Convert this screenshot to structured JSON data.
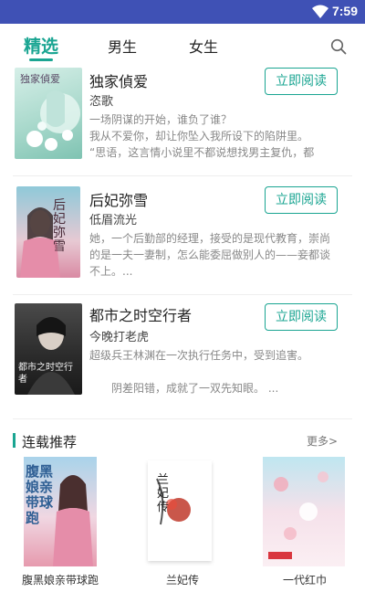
{
  "status_bar": {
    "time": "7:59",
    "wifi_icon": "wifi-icon"
  },
  "tabs": [
    {
      "label": "精选",
      "active": true
    },
    {
      "label": "男生",
      "active": false
    },
    {
      "label": "女生",
      "active": false
    }
  ],
  "search_icon": "search-icon",
  "books": [
    {
      "title": "独家偵爱",
      "author": "恣歌",
      "desc": "一场阴谋的开始，谁负了谁？\n我从不爱你，却让你坠入我所设下的陷阱里。\n“思语，这言情小说里不都说想找男主复仇，都要…",
      "button": "立即阅读",
      "cover_text": "独家偵爱"
    },
    {
      "title": "后妃弥雪",
      "author": "低眉流光",
      "desc": "她，一个后勤部的经理，接受的是现代教育，崇尚的是一夫一妻制，怎么能委屈做别人的——妾都谈不上。...",
      "button": "立即阅读",
      "cover_text": "后妃弥雪"
    },
    {
      "title": "都市之时空行者",
      "author": "今晚打老虎",
      "desc": "超级兵王林渊在一次执行任务中，受到追害。\n\n　　阴差阳错，成就了一双先知眼。 ...",
      "button": "立即阅读",
      "cover_text": "都市之时空行者"
    }
  ],
  "section": {
    "title": "连载推荐",
    "more": "更多>"
  },
  "recommend": [
    {
      "name": "腹黑娘亲带球跑",
      "cover_text": "腹黑娘亲带球跑"
    },
    {
      "name": "兰妃传",
      "cover_text": "兰妃传"
    },
    {
      "name": "一代红巾",
      "cover_text": ""
    }
  ],
  "colors": {
    "accent": "#1aa592",
    "status_bar": "#3f51b5"
  }
}
